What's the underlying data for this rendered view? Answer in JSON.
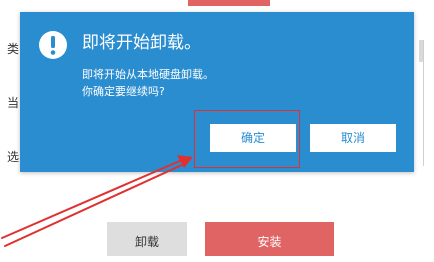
{
  "background": {
    "side_labels": [
      "类型",
      "当前",
      "选择"
    ],
    "buttons": {
      "uninstall_label": "卸载",
      "install_label": "安装"
    }
  },
  "dialog": {
    "icon": "exclamation-circle-icon",
    "title": "即将开始卸载。",
    "message_lines": [
      "即将开始从本地硬盘卸载。",
      "你确定要继续吗?"
    ],
    "ok_label": "确定",
    "cancel_label": "取消"
  },
  "colors": {
    "dialog_background": "#2a8dd0",
    "dialog_text": "#ffffff",
    "button_text": "#2a8dd0",
    "accent_red": "#e06464",
    "annotation_red": "#e03030",
    "secondary_button": "#dedede"
  }
}
